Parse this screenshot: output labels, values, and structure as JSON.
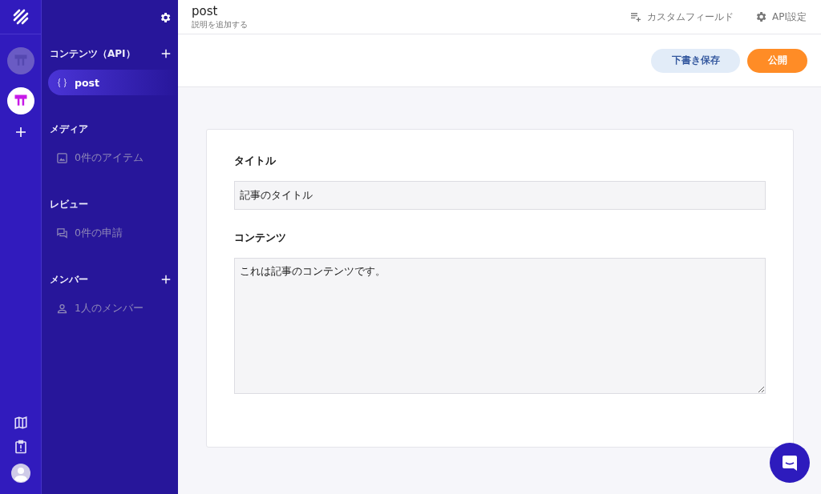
{
  "rail": {
    "apps": [
      {
        "selected": false
      },
      {
        "selected": true
      }
    ]
  },
  "sidebar": {
    "sections": [
      {
        "title": "コンテンツ（API）",
        "add_button": true,
        "items": [
          {
            "kind": "api",
            "label": "post",
            "selected": true
          }
        ]
      },
      {
        "title": "メディア",
        "add_button": false,
        "items": [
          {
            "kind": "media",
            "label": "0件のアイテム",
            "selected": false
          }
        ]
      },
      {
        "title": "レビュー",
        "add_button": false,
        "items": [
          {
            "kind": "review",
            "label": "0件の申請",
            "selected": false
          }
        ]
      },
      {
        "title": "メンバー",
        "add_button": true,
        "items": [
          {
            "kind": "member",
            "label": "1人のメンバー",
            "selected": false
          }
        ]
      }
    ]
  },
  "header": {
    "title": "post",
    "description": "説明を追加する",
    "actions": [
      {
        "kind": "fields",
        "label": "カスタムフィールド"
      },
      {
        "kind": "settings",
        "label": "API設定"
      }
    ]
  },
  "buttons": [
    {
      "kind": "draft",
      "label": "下書き保存"
    },
    {
      "kind": "publish",
      "label": "公開"
    }
  ],
  "form": {
    "fields": [
      {
        "kind": "text",
        "label": "タイトル",
        "value": "記事のタイトル"
      },
      {
        "kind": "textarea",
        "label": "コンテンツ",
        "value": "これは記事のコンテンツです。"
      }
    ]
  }
}
